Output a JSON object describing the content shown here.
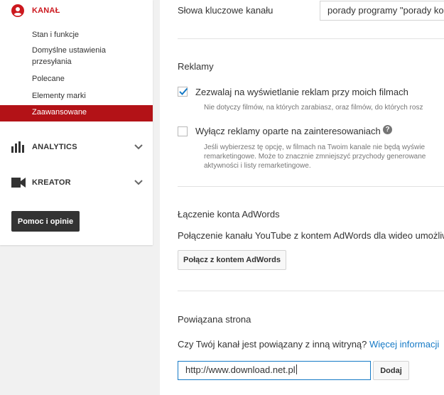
{
  "sidebar": {
    "kanal": {
      "label": "KANAŁ"
    },
    "items": [
      {
        "label": "Stan i funkcje"
      },
      {
        "label": "Domyślne ustawienia przesyłania"
      },
      {
        "label": "Polecane"
      },
      {
        "label": "Elementy marki"
      },
      {
        "label": "Zaawansowane",
        "active": true
      }
    ],
    "analytics": {
      "label": "ANALYTICS"
    },
    "kreator": {
      "label": "KREATOR"
    },
    "help_button": "Pomoc i opinie"
  },
  "main": {
    "keywords": {
      "label": "Słowa kluczowe kanału",
      "value": "porady programy \"porady kom"
    },
    "ads": {
      "title": "Reklamy",
      "allow_ads": {
        "label": "Zezwalaj na wyświetlanie reklam przy moich filmach",
        "checked": true,
        "note": "Nie dotyczy filmów, na których zarabiasz, oraz filmów, do których rosz"
      },
      "disable_interest_ads": {
        "label": "Wyłącz reklamy oparte na zainteresowaniach",
        "checked": false,
        "note_lines": [
          "Jeśli wybierzesz tę opcję, w filmach na Twoim kanale nie będą wyświe",
          "remarketingowe. Może to znacznie zmniejszyć przychody generowane",
          "aktywności i listy remarketingowe."
        ]
      }
    },
    "adwords": {
      "title": "Łączenie konta AdWords",
      "description": "Połączenie kanału YouTube z kontem AdWords dla wideo umożliw",
      "button": "Połącz z kontem AdWords"
    },
    "linked_site": {
      "title": "Powiązana strona",
      "question": "Czy Twój kanał jest powiązany z inną witryną?",
      "more_info": "Więcej informacji",
      "url_value": "http://www.download.net.pl",
      "add_button": "Dodaj"
    }
  },
  "colors": {
    "accent_red": "#cc181e",
    "active_bg": "#b31217",
    "link_blue": "#167ac6",
    "dark_button": "#333333"
  },
  "icons": {
    "kanal": "user-circle-icon",
    "analytics": "bar-chart-icon",
    "kreator": "video-camera-icon",
    "chevron": "chevron-down-icon",
    "help": "question-mark-icon",
    "check": "checkmark-icon"
  }
}
